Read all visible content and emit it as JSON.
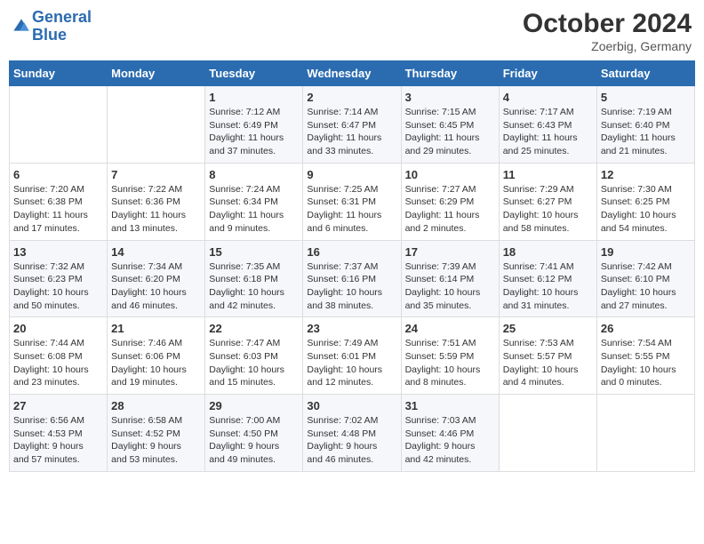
{
  "header": {
    "logo_line1": "General",
    "logo_line2": "Blue",
    "month": "October 2024",
    "location": "Zoerbig, Germany"
  },
  "days_of_week": [
    "Sunday",
    "Monday",
    "Tuesday",
    "Wednesday",
    "Thursday",
    "Friday",
    "Saturday"
  ],
  "weeks": [
    [
      {
        "num": "",
        "detail": ""
      },
      {
        "num": "",
        "detail": ""
      },
      {
        "num": "1",
        "detail": "Sunrise: 7:12 AM\nSunset: 6:49 PM\nDaylight: 11 hours\nand 37 minutes."
      },
      {
        "num": "2",
        "detail": "Sunrise: 7:14 AM\nSunset: 6:47 PM\nDaylight: 11 hours\nand 33 minutes."
      },
      {
        "num": "3",
        "detail": "Sunrise: 7:15 AM\nSunset: 6:45 PM\nDaylight: 11 hours\nand 29 minutes."
      },
      {
        "num": "4",
        "detail": "Sunrise: 7:17 AM\nSunset: 6:43 PM\nDaylight: 11 hours\nand 25 minutes."
      },
      {
        "num": "5",
        "detail": "Sunrise: 7:19 AM\nSunset: 6:40 PM\nDaylight: 11 hours\nand 21 minutes."
      }
    ],
    [
      {
        "num": "6",
        "detail": "Sunrise: 7:20 AM\nSunset: 6:38 PM\nDaylight: 11 hours\nand 17 minutes."
      },
      {
        "num": "7",
        "detail": "Sunrise: 7:22 AM\nSunset: 6:36 PM\nDaylight: 11 hours\nand 13 minutes."
      },
      {
        "num": "8",
        "detail": "Sunrise: 7:24 AM\nSunset: 6:34 PM\nDaylight: 11 hours\nand 9 minutes."
      },
      {
        "num": "9",
        "detail": "Sunrise: 7:25 AM\nSunset: 6:31 PM\nDaylight: 11 hours\nand 6 minutes."
      },
      {
        "num": "10",
        "detail": "Sunrise: 7:27 AM\nSunset: 6:29 PM\nDaylight: 11 hours\nand 2 minutes."
      },
      {
        "num": "11",
        "detail": "Sunrise: 7:29 AM\nSunset: 6:27 PM\nDaylight: 10 hours\nand 58 minutes."
      },
      {
        "num": "12",
        "detail": "Sunrise: 7:30 AM\nSunset: 6:25 PM\nDaylight: 10 hours\nand 54 minutes."
      }
    ],
    [
      {
        "num": "13",
        "detail": "Sunrise: 7:32 AM\nSunset: 6:23 PM\nDaylight: 10 hours\nand 50 minutes."
      },
      {
        "num": "14",
        "detail": "Sunrise: 7:34 AM\nSunset: 6:20 PM\nDaylight: 10 hours\nand 46 minutes."
      },
      {
        "num": "15",
        "detail": "Sunrise: 7:35 AM\nSunset: 6:18 PM\nDaylight: 10 hours\nand 42 minutes."
      },
      {
        "num": "16",
        "detail": "Sunrise: 7:37 AM\nSunset: 6:16 PM\nDaylight: 10 hours\nand 38 minutes."
      },
      {
        "num": "17",
        "detail": "Sunrise: 7:39 AM\nSunset: 6:14 PM\nDaylight: 10 hours\nand 35 minutes."
      },
      {
        "num": "18",
        "detail": "Sunrise: 7:41 AM\nSunset: 6:12 PM\nDaylight: 10 hours\nand 31 minutes."
      },
      {
        "num": "19",
        "detail": "Sunrise: 7:42 AM\nSunset: 6:10 PM\nDaylight: 10 hours\nand 27 minutes."
      }
    ],
    [
      {
        "num": "20",
        "detail": "Sunrise: 7:44 AM\nSunset: 6:08 PM\nDaylight: 10 hours\nand 23 minutes."
      },
      {
        "num": "21",
        "detail": "Sunrise: 7:46 AM\nSunset: 6:06 PM\nDaylight: 10 hours\nand 19 minutes."
      },
      {
        "num": "22",
        "detail": "Sunrise: 7:47 AM\nSunset: 6:03 PM\nDaylight: 10 hours\nand 15 minutes."
      },
      {
        "num": "23",
        "detail": "Sunrise: 7:49 AM\nSunset: 6:01 PM\nDaylight: 10 hours\nand 12 minutes."
      },
      {
        "num": "24",
        "detail": "Sunrise: 7:51 AM\nSunset: 5:59 PM\nDaylight: 10 hours\nand 8 minutes."
      },
      {
        "num": "25",
        "detail": "Sunrise: 7:53 AM\nSunset: 5:57 PM\nDaylight: 10 hours\nand 4 minutes."
      },
      {
        "num": "26",
        "detail": "Sunrise: 7:54 AM\nSunset: 5:55 PM\nDaylight: 10 hours\nand 0 minutes."
      }
    ],
    [
      {
        "num": "27",
        "detail": "Sunrise: 6:56 AM\nSunset: 4:53 PM\nDaylight: 9 hours\nand 57 minutes."
      },
      {
        "num": "28",
        "detail": "Sunrise: 6:58 AM\nSunset: 4:52 PM\nDaylight: 9 hours\nand 53 minutes."
      },
      {
        "num": "29",
        "detail": "Sunrise: 7:00 AM\nSunset: 4:50 PM\nDaylight: 9 hours\nand 49 minutes."
      },
      {
        "num": "30",
        "detail": "Sunrise: 7:02 AM\nSunset: 4:48 PM\nDaylight: 9 hours\nand 46 minutes."
      },
      {
        "num": "31",
        "detail": "Sunrise: 7:03 AM\nSunset: 4:46 PM\nDaylight: 9 hours\nand 42 minutes."
      },
      {
        "num": "",
        "detail": ""
      },
      {
        "num": "",
        "detail": ""
      }
    ]
  ]
}
